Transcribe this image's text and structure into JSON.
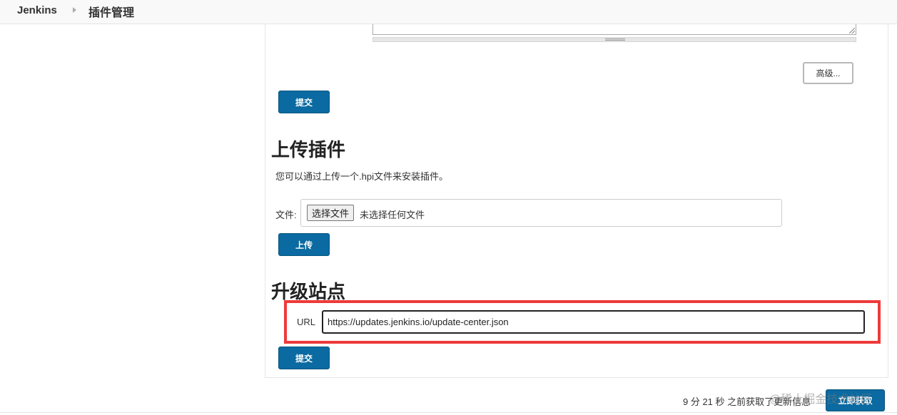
{
  "breadcrumb": {
    "root": "Jenkins",
    "page": "插件管理"
  },
  "advanced": {
    "advanced_label": "高级..."
  },
  "submit": {
    "label": "提交"
  },
  "upload": {
    "heading": "上传插件",
    "description": "您可以通过上传一个.hpi文件来安装插件。",
    "file_label": "文件:",
    "choose_label": "选择文件",
    "no_file": "未选择任何文件",
    "upload_label": "上传"
  },
  "site": {
    "heading": "升级站点",
    "url_label": "URL",
    "url_value": "https://updates.jenkins.io/update-center.json",
    "submit_label": "提交"
  },
  "footer": {
    "update_info": "9 分 21 秒 之前获取了更新信息",
    "fetch_label": "立即获取",
    "watermark": "@稀土掘金技术社区"
  },
  "colors": {
    "primary": "#0a6aa1",
    "highlight": "#ee3a3a"
  }
}
